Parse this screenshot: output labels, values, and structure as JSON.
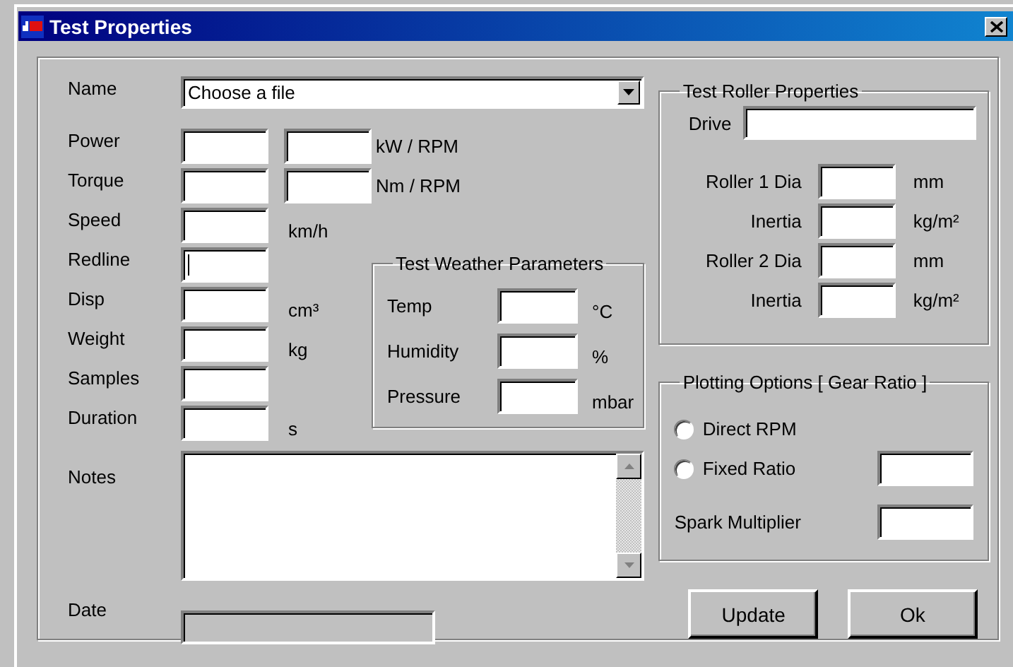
{
  "window": {
    "title": "Test Properties"
  },
  "name": {
    "label": "Name",
    "value": "Choose a file"
  },
  "fields": [
    {
      "label": "Power",
      "kind": "pair",
      "unit": "kW / RPM",
      "focused": false
    },
    {
      "label": "Torque",
      "kind": "pair",
      "unit": "Nm / RPM",
      "focused": false
    },
    {
      "label": "Speed",
      "kind": "single",
      "unit": "km/h",
      "focused": false
    },
    {
      "label": "Redline",
      "kind": "single",
      "focused": true
    },
    {
      "label": "Disp",
      "kind": "single",
      "unit": "cm³",
      "focused": false
    },
    {
      "label": "Weight",
      "kind": "single",
      "unit": "kg",
      "focused": false
    },
    {
      "label": "Samples",
      "kind": "single",
      "focused": false
    },
    {
      "label": "Duration",
      "kind": "single",
      "unit": "s",
      "focused": false
    }
  ],
  "weather": {
    "title": "Test Weather Parameters",
    "fields": [
      {
        "label": "Temp",
        "unit": "°C"
      },
      {
        "label": "Humidity",
        "unit": "%"
      },
      {
        "label": "Pressure",
        "unit": "mbar"
      }
    ]
  },
  "notes": {
    "label": "Notes"
  },
  "date": {
    "label": "Date",
    "disabled": true
  },
  "roller": {
    "title": "Test Roller Properties",
    "drive_label": "Drive",
    "fields": [
      {
        "label": "Roller 1 Dia",
        "unit": "mm"
      },
      {
        "label": "Inertia",
        "unit": "kg/m²"
      },
      {
        "label": "Roller 2 Dia",
        "unit": "mm"
      },
      {
        "label": "Inertia",
        "unit": "kg/m²"
      }
    ]
  },
  "plotting": {
    "title": "Plotting Options [ Gear Ratio ]",
    "options": [
      {
        "label": "Direct RPM",
        "kind": "radio",
        "selected": false
      },
      {
        "label": "Fixed Ratio",
        "kind": "radio_field",
        "selected": false
      }
    ],
    "spark_label": "Spark Multiplier"
  },
  "buttons": [
    "Update",
    "Ok"
  ]
}
